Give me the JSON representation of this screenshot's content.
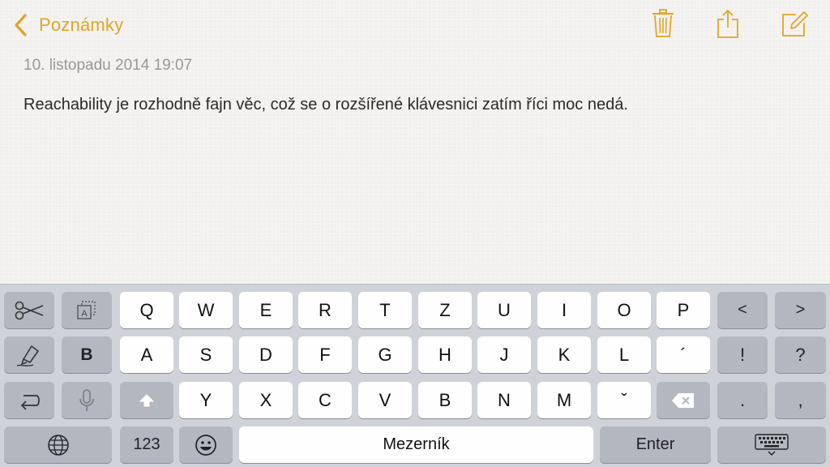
{
  "nav": {
    "back_label": "Poznámky"
  },
  "note": {
    "date": "10. listopadu 2014 19:07",
    "text": "Reachability je rozhodně fajn věc, což se o rozšířené klávesnici zatím říci moc nedá."
  },
  "keyboard": {
    "row1": [
      "Q",
      "W",
      "E",
      "R",
      "T",
      "Z",
      "U",
      "I",
      "O",
      "P"
    ],
    "row2": [
      "A",
      "S",
      "D",
      "F",
      "G",
      "H",
      "J",
      "K",
      "L",
      "´"
    ],
    "row3": [
      "Y",
      "X",
      "C",
      "V",
      "B",
      "N",
      "M",
      "ˇ"
    ],
    "bold_key": "B",
    "nav_left": "<",
    "nav_right": ">",
    "exclam": "!",
    "question": "?",
    "period": ".",
    "comma": ",",
    "numbers_key": "123",
    "space_label": "Mezerník",
    "enter_label": "Enter"
  },
  "colors": {
    "accent": "#e0a526",
    "keyboard_bg": "#cfd3d9",
    "key_light": "#fefefe",
    "key_dark": "#b3b8c0"
  },
  "icons": {
    "back": "chevron-left-icon",
    "trash": "trash-icon",
    "share": "share-icon",
    "compose": "compose-icon",
    "cut": "scissors-icon",
    "copy": "copy-text-icon",
    "paste": "paste-brush-icon",
    "undo": "undo-icon",
    "dictation": "microphone-icon",
    "shift": "shift-icon",
    "backspace": "backspace-icon",
    "globe": "globe-icon",
    "emoji": "emoji-icon",
    "dismiss": "keyboard-dismiss-icon"
  }
}
